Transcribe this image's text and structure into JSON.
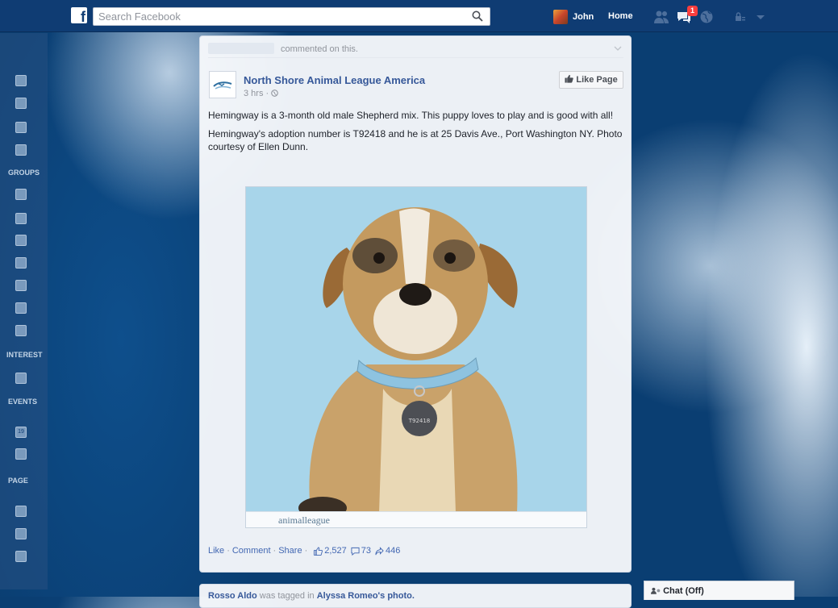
{
  "topbar": {
    "logo": "f",
    "search_placeholder": "Search Facebook",
    "user_name": "John",
    "home_label": "Home",
    "notifications_count": "1"
  },
  "leftrail": {
    "sections": [
      "GROUPS",
      "INTEREST",
      "EVENTS",
      "PAGE"
    ],
    "calendar_day": "19"
  },
  "post": {
    "activity_text": "commented on this.",
    "page_name": "North Shore Animal League America",
    "time": "3 hrs",
    "like_page_label": "Like Page",
    "paragraph1": "Hemingway is a 3-month old male Shepherd mix. This puppy loves to play and is good with all!",
    "paragraph2": "Hemingway's adoption number is T92418 and he is at 25 Davis Ave., Port Washington NY. Photo courtesy of Ellen Dunn.",
    "photo_footer": "animalleague",
    "actions": {
      "like": "Like",
      "comment": "Comment",
      "share": "Share",
      "likes_count": "2,527",
      "comments_count": "73",
      "shares_count": "446"
    }
  },
  "next_post": {
    "actor": "Rosso Aldo",
    "verb": "was tagged in",
    "target": "Alyssa Romeo's photo."
  },
  "chat": {
    "label": "Chat (Off)"
  },
  "colors": {
    "topbar": "#0f3c73",
    "link": "#365899",
    "badge": "#fa3e3e"
  }
}
